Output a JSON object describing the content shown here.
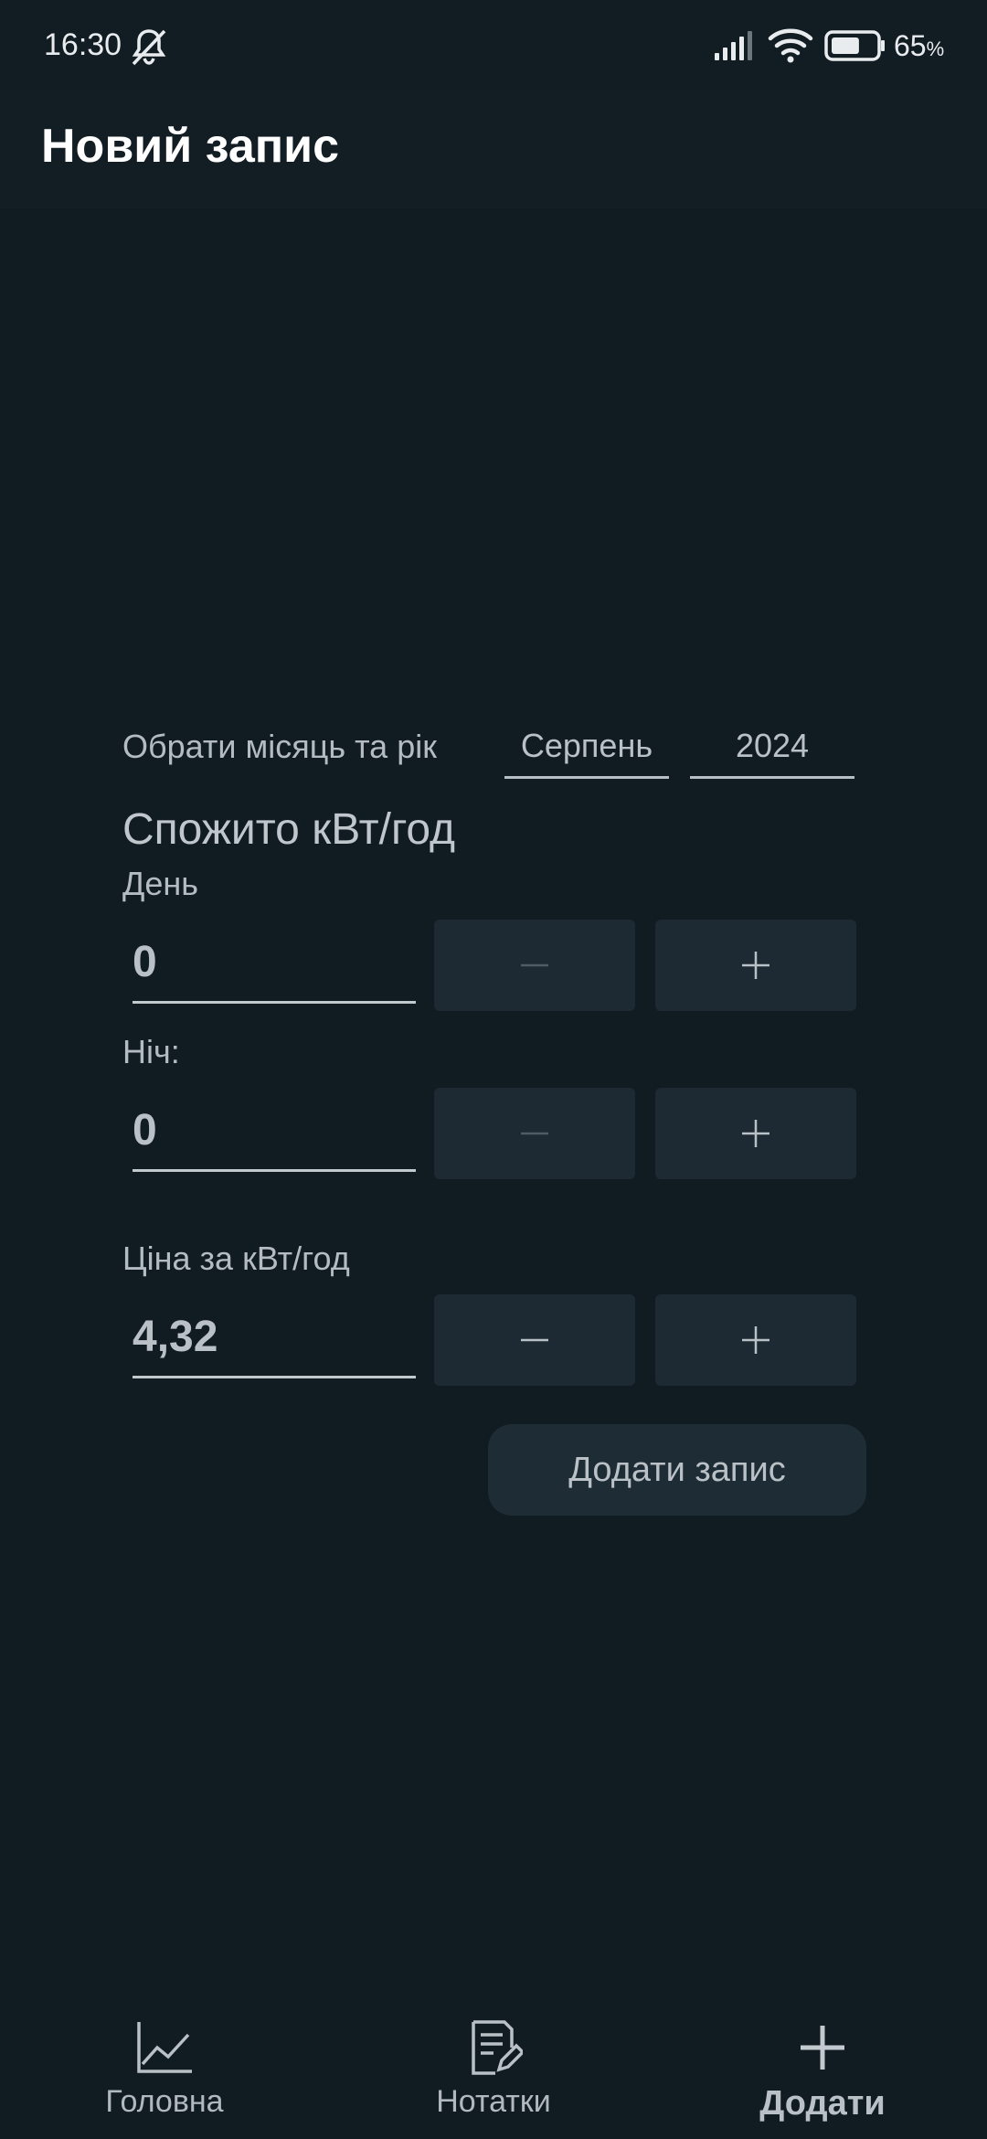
{
  "status_bar": {
    "time": "16:30",
    "battery_percent": "65",
    "battery_unit": "%",
    "battery_level": 0.65,
    "icons": [
      "bell-off-icon",
      "signal-icon",
      "wifi-icon",
      "battery-icon"
    ]
  },
  "app_bar": {
    "title": "Новий запис"
  },
  "form": {
    "month_year_label": "Обрати місяць та рік",
    "month_value": "Серпень",
    "year_value": "2024",
    "consumed_label": "Спожито кВт/год",
    "day_label": "День",
    "day_value": "0",
    "night_label": "Ніч:",
    "night_value": "0",
    "price_label": "Ціна за кВт/год",
    "price_value": "4,32",
    "minus_symbol": "minus-icon",
    "plus_symbol": "plus-icon",
    "submit_label": "Додати запис"
  },
  "bottom_nav": {
    "items": [
      {
        "label": "Головна",
        "icon": "chart-line-icon",
        "active": false
      },
      {
        "label": "Нотатки",
        "icon": "notes-edit-icon",
        "active": false
      },
      {
        "label": "Додати",
        "icon": "plus-icon",
        "active": true
      }
    ]
  },
  "colors": {
    "background": "#111b22",
    "button_bg": "#1d2a33",
    "text": "#b9c1c6",
    "title": "#ffffff"
  }
}
